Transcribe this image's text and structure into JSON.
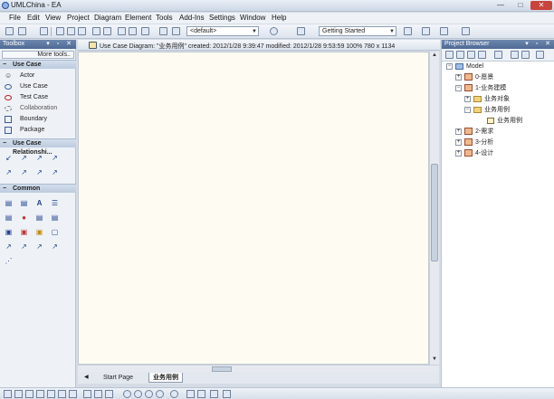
{
  "window": {
    "title": "UMLChina - EA",
    "minimize": "—",
    "maximize": "□",
    "close": "✕"
  },
  "menu": [
    "File",
    "Edit",
    "View",
    "Project",
    "Diagram",
    "Element",
    "Tools",
    "Add-Ins",
    "Settings",
    "Window",
    "Help"
  ],
  "toolbar": {
    "layout_combo": "<default>",
    "workspace_combo": "Getting Started"
  },
  "toolbox": {
    "title": "Toolbox",
    "more_tools": "More tools..",
    "use_case_group": "Use Case",
    "use_case_items": [
      "Actor",
      "Use Case",
      "Test Case",
      "Collaboration",
      "Boundary",
      "Package"
    ],
    "relationship_group": "Use Case Relationshi...",
    "common_group": "Common"
  },
  "diagram_tab": {
    "text": "Use Case Diagram: \"业务用例\"   created: 2012/1/28 9:39:47  modified: 2012/1/28 9:53:59   100%   780 x 1134"
  },
  "bottom_tabs": {
    "start": "Start Page",
    "current": "业务用例"
  },
  "browser": {
    "title": "Project Browser",
    "root": "Model",
    "nodes": [
      "0-愿景",
      "1-业务建模",
      "业务对象",
      "业务用例",
      "业务用例",
      "2-需求",
      "3-分析",
      "4-设计"
    ]
  },
  "icons": {
    "app": "uml-app-icon",
    "actor": "actor-icon",
    "use_case": "use-case-icon",
    "test_case": "test-case-icon",
    "collaboration": "collaboration-icon",
    "boundary": "boundary-icon",
    "package": "package-icon"
  },
  "colors": {
    "canvas": "#fefcf2",
    "panel_header": "#5a76a0",
    "close": "#c9443c"
  }
}
